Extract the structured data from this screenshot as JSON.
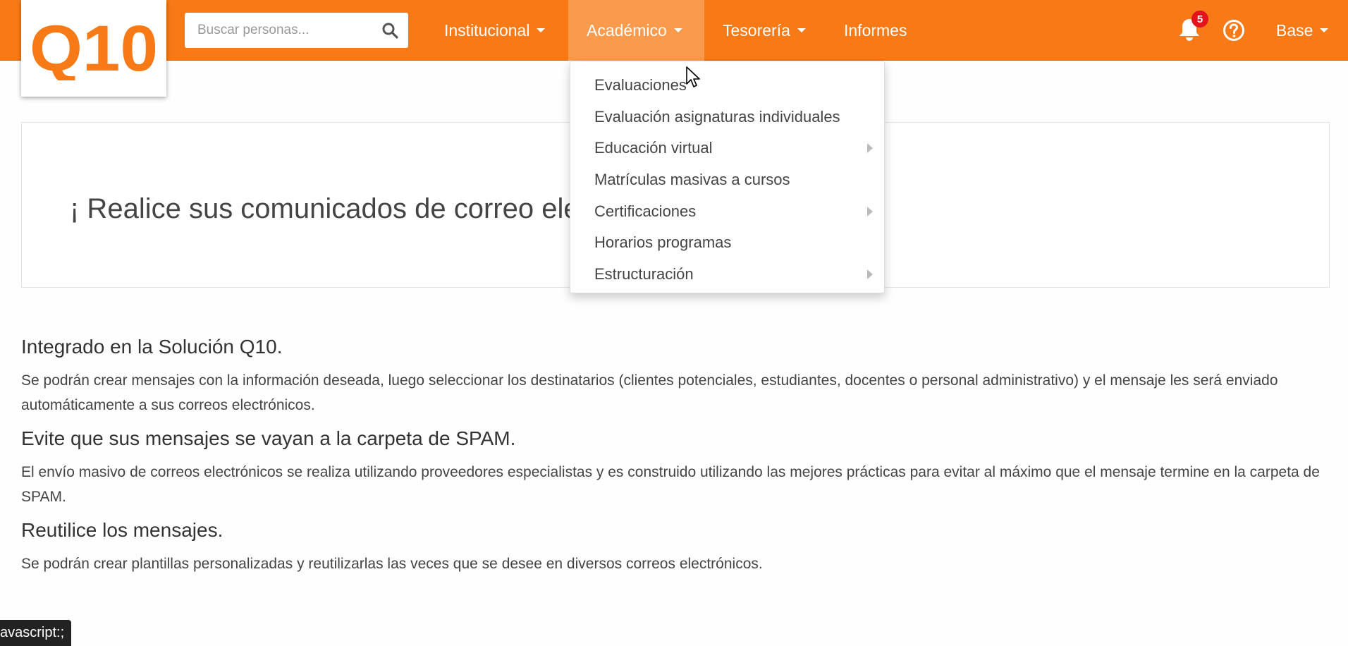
{
  "logo": {
    "text": "Q10"
  },
  "search": {
    "placeholder": "Buscar personas..."
  },
  "nav": [
    {
      "label": "Institucional"
    },
    {
      "label": "Académico"
    },
    {
      "label": "Tesorería"
    },
    {
      "label": "Informes"
    }
  ],
  "notifications": {
    "count": "5"
  },
  "user_menu": {
    "label": "Base"
  },
  "dropdown": [
    {
      "label": "Evaluaciones"
    },
    {
      "label": "Evaluación asignaturas individuales"
    },
    {
      "label": "Educación virtual"
    },
    {
      "label": "Matrículas masivas a cursos"
    },
    {
      "label": "Certificaciones"
    },
    {
      "label": "Horarios programas"
    },
    {
      "label": "Estructuración"
    }
  ],
  "banner": {
    "text": "¡ Realice sus comunicados de correo electrónico"
  },
  "sections": [
    {
      "title": "Integrado en la Solución Q10.",
      "body": "Se podrán crear mensajes con la información deseada, luego seleccionar los destinatarios (clientes potenciales, estudiantes, docentes o personal administrativo) y el mensaje les será enviado automáticamente a sus correos electrónicos."
    },
    {
      "title": "Evite que sus mensajes se vayan a la carpeta de SPAM.",
      "body": "El envío masivo de correos electrónicos se realiza utilizando proveedores especialistas y es construido utilizando las mejores prácticas para evitar al máximo que el mensaje termine en la carpeta de SPAM."
    },
    {
      "title": "Reutilice los mensajes.",
      "body": "Se podrán crear plantillas personalizadas y reutilizarlas las veces que se desee en diversos correos electrónicos."
    }
  ],
  "status_bar": {
    "text": "avascript:;"
  },
  "colors": {
    "navbar": "#f77a17",
    "active_nav": "#f99a4d",
    "badge": "#e3121c",
    "logo": "#f77a17"
  }
}
